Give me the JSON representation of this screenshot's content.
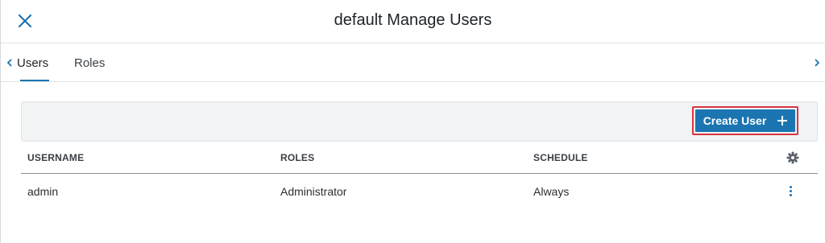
{
  "header": {
    "title": "default Manage Users",
    "close_icon": "close-icon"
  },
  "tabs": {
    "items": [
      {
        "label": "Users",
        "active": true
      },
      {
        "label": "Roles",
        "active": false
      }
    ],
    "left_icon": "chevron-left-icon",
    "right_icon": "chevron-right-icon"
  },
  "toolbar": {
    "create_label": "Create User",
    "create_icon": "plus-icon"
  },
  "table": {
    "columns": [
      "USERNAME",
      "ROLES",
      "SCHEDULE"
    ],
    "settings_icon": "gear-icon",
    "rows": [
      {
        "username": "admin",
        "roles": "Administrator",
        "schedule": "Always",
        "menu_icon": "kebab-menu-icon"
      }
    ]
  },
  "colors": {
    "accent": "#1b75b1",
    "highlight_outline": "#d9343f",
    "toolbar_bg": "#f2f3f5"
  }
}
